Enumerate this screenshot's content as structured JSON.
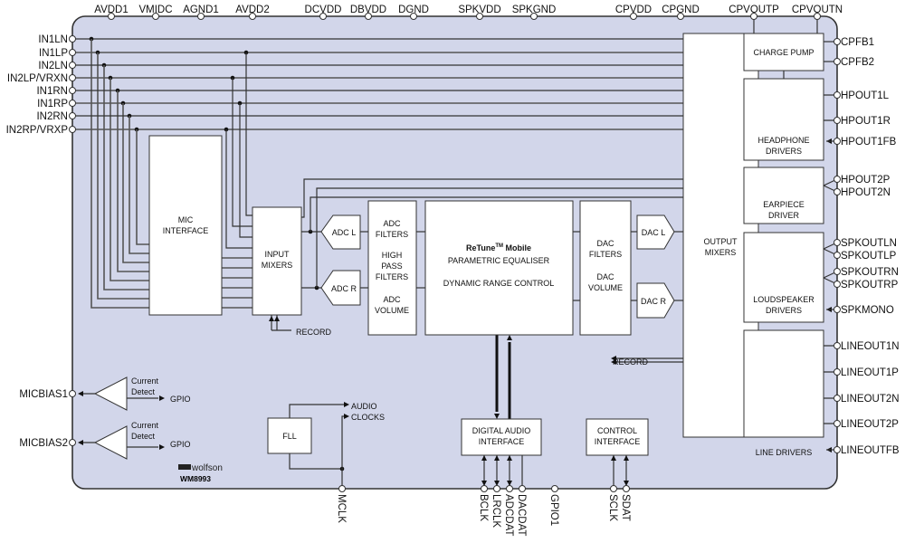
{
  "colors": {
    "chip_fill": "#d2d6ea",
    "chip_border": "#333333",
    "block_fill": "#ffffff"
  },
  "chip": {
    "brand": "wolfson",
    "part": "WM8993"
  },
  "pins": {
    "top": [
      "AVDD1",
      "VMIDC",
      "AGND1",
      "AVDD2",
      "DCVDD",
      "DBVDD",
      "DGND",
      "SPKVDD",
      "SPKGND",
      "CPVDD",
      "CPGND",
      "CPVOUTP",
      "CPVOUTN"
    ],
    "left": [
      "IN1LN",
      "IN1LP",
      "IN2LN",
      "IN2LP/VRXN",
      "IN1RN",
      "IN1RP",
      "IN2RN",
      "IN2RP/VRXP",
      "MICBIAS1",
      "MICBIAS2"
    ],
    "right": [
      "CPFB1",
      "CPFB2",
      "HPOUT1L",
      "HPOUT1R",
      "HPOUT1FB",
      "HPOUT2P",
      "HPOUT2N",
      "SPKOUTLN",
      "SPKOUTLP",
      "SPKOUTRN",
      "SPKOUTRP",
      "SPKMONO",
      "LINEOUT1N",
      "LINEOUT1P",
      "LINEOUT2N",
      "LINEOUT2P",
      "LINEOUTFB"
    ],
    "bottom": [
      "MCLK",
      "BCLK",
      "LRCLK",
      "ADCDAT",
      "DACDAT",
      "GPIO1",
      "SCLK",
      "SDAT"
    ]
  },
  "blocks": {
    "mic_interface": [
      "MIC",
      "INTERFACE"
    ],
    "input_mixers": [
      "INPUT",
      "MIXERS"
    ],
    "adc_l": "ADC L",
    "adc_r": "ADC R",
    "adc_filters": [
      "ADC",
      "FILTERS",
      "HIGH",
      "PASS",
      "FILTERS",
      "ADC",
      "VOLUME"
    ],
    "retune": {
      "name": "ReTune",
      "sup": "TM",
      "suffix": " Mobile",
      "line2": "PARAMETRIC EQUALISER",
      "line3": "DYNAMIC RANGE CONTROL"
    },
    "dac_filters": [
      "DAC",
      "FILTERS",
      "DAC",
      "VOLUME"
    ],
    "dac_l": "DAC L",
    "dac_r": "DAC R",
    "output_mixers": [
      "OUTPUT",
      "MIXERS"
    ],
    "charge_pump": "CHARGE PUMP",
    "headphone": [
      "HEADPHONE",
      "DRIVERS"
    ],
    "earpiece": [
      "EARPIECE",
      "DRIVER"
    ],
    "loudspeaker": [
      "LOUDSPEAKER",
      "DRIVERS"
    ],
    "line_drivers": "LINE DRIVERS",
    "dai": [
      "DIGITAL AUDIO",
      "INTERFACE"
    ],
    "control": [
      "CONTROL",
      "INTERFACE"
    ],
    "fll": "FLL",
    "audio_clocks": [
      "AUDIO",
      "CLOCKS"
    ],
    "record": "RECORD",
    "current_detect": [
      "Current",
      "Detect"
    ],
    "gpio": "GPIO"
  }
}
